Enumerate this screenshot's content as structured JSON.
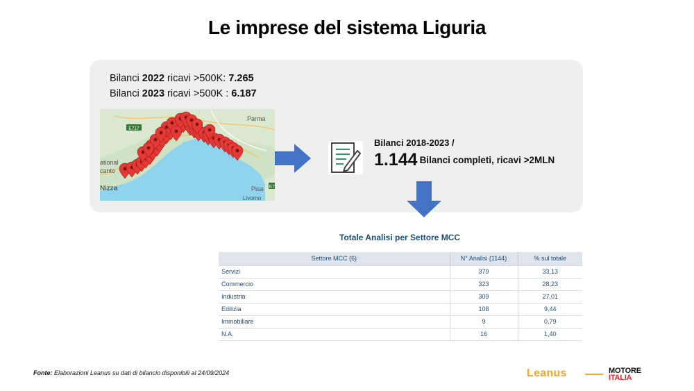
{
  "page_title": "Le imprese del sistema Liguria",
  "bilanci": [
    {
      "prefix": "Bilanci ",
      "year": "2022",
      "middle": " ricavi >500K: ",
      "value": "7.265"
    },
    {
      "prefix": "Bilanci ",
      "year": "2023",
      "middle": " ricavi >500K : ",
      "value": "6.187"
    }
  ],
  "map": {
    "labels": {
      "e717": "E717",
      "parma": "Parma",
      "national": "ational",
      "cantonal": "canto",
      "nizza": "Nizza",
      "pisa": "Pisa",
      "livorno": "Livorno",
      "e7": "E7"
    }
  },
  "summary": {
    "top": "Bilanci 2018-2023 /",
    "big": "1.144",
    "text": "Bilanci completi, ricavi >2MLN"
  },
  "table": {
    "title": "Totale Analisi per Settore MCC",
    "headers": [
      "Settore MCC (6)",
      "N° Analisi (1144)",
      "% sul totale"
    ],
    "rows": [
      [
        "Servizi",
        "379",
        "33,13"
      ],
      [
        "Commercio",
        "323",
        "28,23"
      ],
      [
        "Industria",
        "309",
        "27,01"
      ],
      [
        "Edilizia",
        "108",
        "9,44"
      ],
      [
        "Immobiliare",
        "9",
        "0,79"
      ],
      [
        "N.A.",
        "16",
        "1,40"
      ]
    ]
  },
  "footer": {
    "fonte_label": "Fonte:",
    "fonte_text": " Elaborazioni Leanus su dati di bilancio disponibili al 24/09/2024",
    "logo_leanus": "Leanus",
    "logo_motore_1": "MOTORE",
    "logo_motore_2": "ITALIA"
  },
  "colors": {
    "accent_blue": "#4472c4",
    "table_text": "#1f4e79",
    "pin_red": "#e53935",
    "leanus_orange": "#f5a623"
  }
}
